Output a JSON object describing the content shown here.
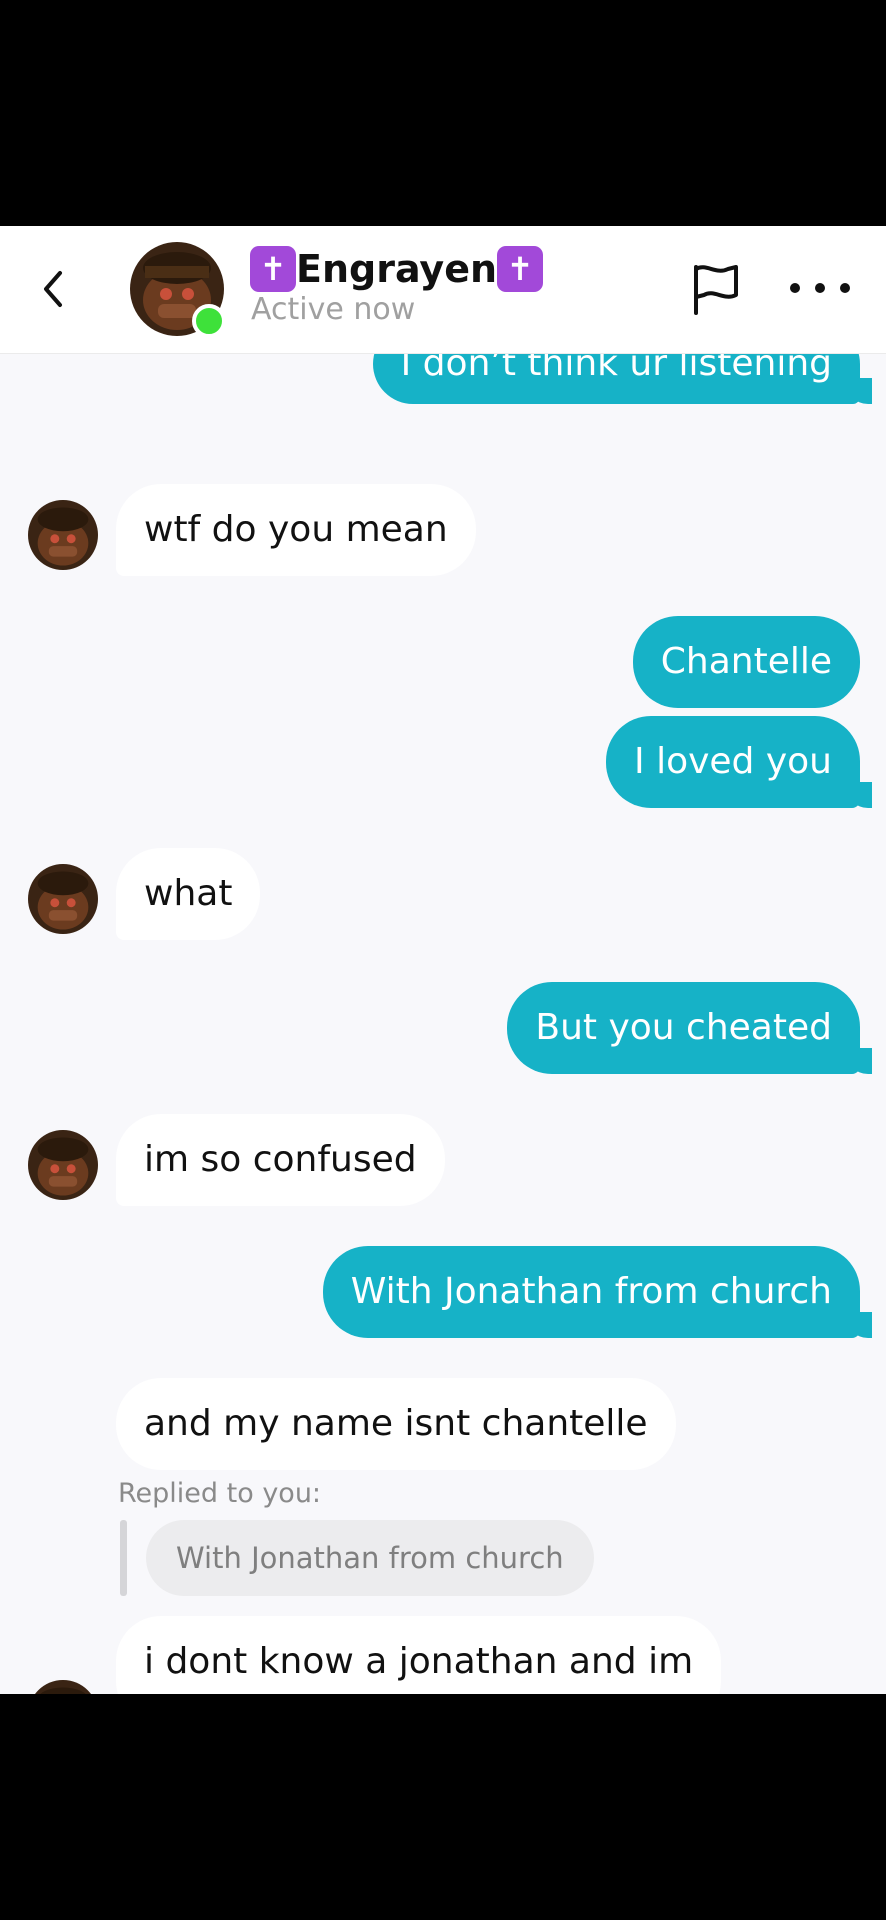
{
  "header": {
    "title": "Engrayen",
    "title_prefix": "✝",
    "title_suffix": "✝",
    "status": "Active now"
  },
  "messages": [
    {
      "direction": "out",
      "text": "I don’t think ur listening"
    },
    {
      "direction": "in",
      "text": "wtf do you mean"
    },
    {
      "direction": "out",
      "text": "Chantelle"
    },
    {
      "direction": "out",
      "text": "I loved you"
    },
    {
      "direction": "in",
      "text": "what"
    },
    {
      "direction": "out",
      "text": "But you cheated"
    },
    {
      "direction": "in",
      "text": "im so confused"
    },
    {
      "direction": "out",
      "text": "With Jonathan from church"
    },
    {
      "direction": "in",
      "text": "and my name isnt chantelle"
    },
    {
      "direction": "in",
      "text": "i dont know a jonathan and im",
      "reply_label": "Replied to you:",
      "reply_quote": "With Jonathan from church"
    }
  ],
  "colors": {
    "outgoing_bubble": "#16b2c7",
    "incoming_bubble": "#ffffff",
    "online_dot": "#3ee13a",
    "cross_badge": "#a249d9"
  },
  "icons": {
    "back": "chevron-left-icon",
    "report": "flag-icon",
    "more": "more-horizontal-icon"
  }
}
